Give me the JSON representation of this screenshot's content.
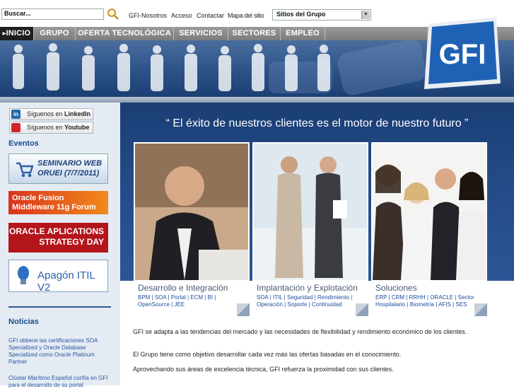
{
  "topbar": {
    "search_placeholder": "Buscar...",
    "links": [
      "GFI-Nosotros",
      "Acceso",
      "Contactar",
      "Mapa del sitio"
    ],
    "group_select": "Sitios del Grupo"
  },
  "nav": [
    "INICIO",
    "GRUPO",
    "OFERTA TECNOLÓGICA",
    "SERVICIOS",
    "SECTORES",
    "EMPLEO"
  ],
  "logo_text": "GFI",
  "sidebar": {
    "linkedin": {
      "prefix": "Síguenos en ",
      "bold": "LinkedIn"
    },
    "youtube": {
      "prefix": "Síguenos en ",
      "bold": "Youtube"
    },
    "eventos_title": "Eventos",
    "seminario_line1": "SEMINARIO WEB",
    "seminario_line2": "ORUEI (7/7/2011)",
    "oracle_fusion_line1": "Oracle Fusion",
    "oracle_fusion_line2": "Middleware 11g Forum",
    "oracle_apps_line1": "ORACLE APLICATIONS",
    "oracle_apps_line2": "STRATEGY DAY",
    "apagon": "Apagón ITIL V2",
    "noticias_title": "Noticias",
    "news": [
      "GFI obtiene las certificaciones SOA Specialized y Oracle Database Specialized como Oracle Platinum Partner",
      "Clúster Marítimo Español confía en GFI para el desarrollo de su portal"
    ]
  },
  "main": {
    "slogan": "“ El éxito de nuestros clientes es el motor de nuestro futuro ”",
    "cards": [
      {
        "title": "Desarrollo e Integración",
        "links": "BPM | SOA | Portal | ECM | BI | OpenSource | JEE"
      },
      {
        "title": "Implantación y Explotación",
        "links": "SOA | ITIL | Seguridad | Rendimiento | Operación | Soporte | Continuidad"
      },
      {
        "title": "Soluciones",
        "links": "ERP | CRM | RRHH | ORACLE | Sector Hospitalario | Biometría | AFIS | SES"
      }
    ],
    "paragraphs": [
      "GFI se adapta a las tendencias del mercado y las necesidades de flexibilidad y rendimiento económico de los clientes.",
      "El Grupo tiene como objetivo desarrollar cada vez más las ofertas basadas en el conocimiento.",
      "Aprovechando sus áreas de excelencia técnica, GFI refuerza la proximidad con sus clientes."
    ]
  },
  "colors": {
    "brand_blue": "#1a4d8c",
    "nav_gray": "#8a8a8a",
    "oracle_red": "#b3151b"
  }
}
